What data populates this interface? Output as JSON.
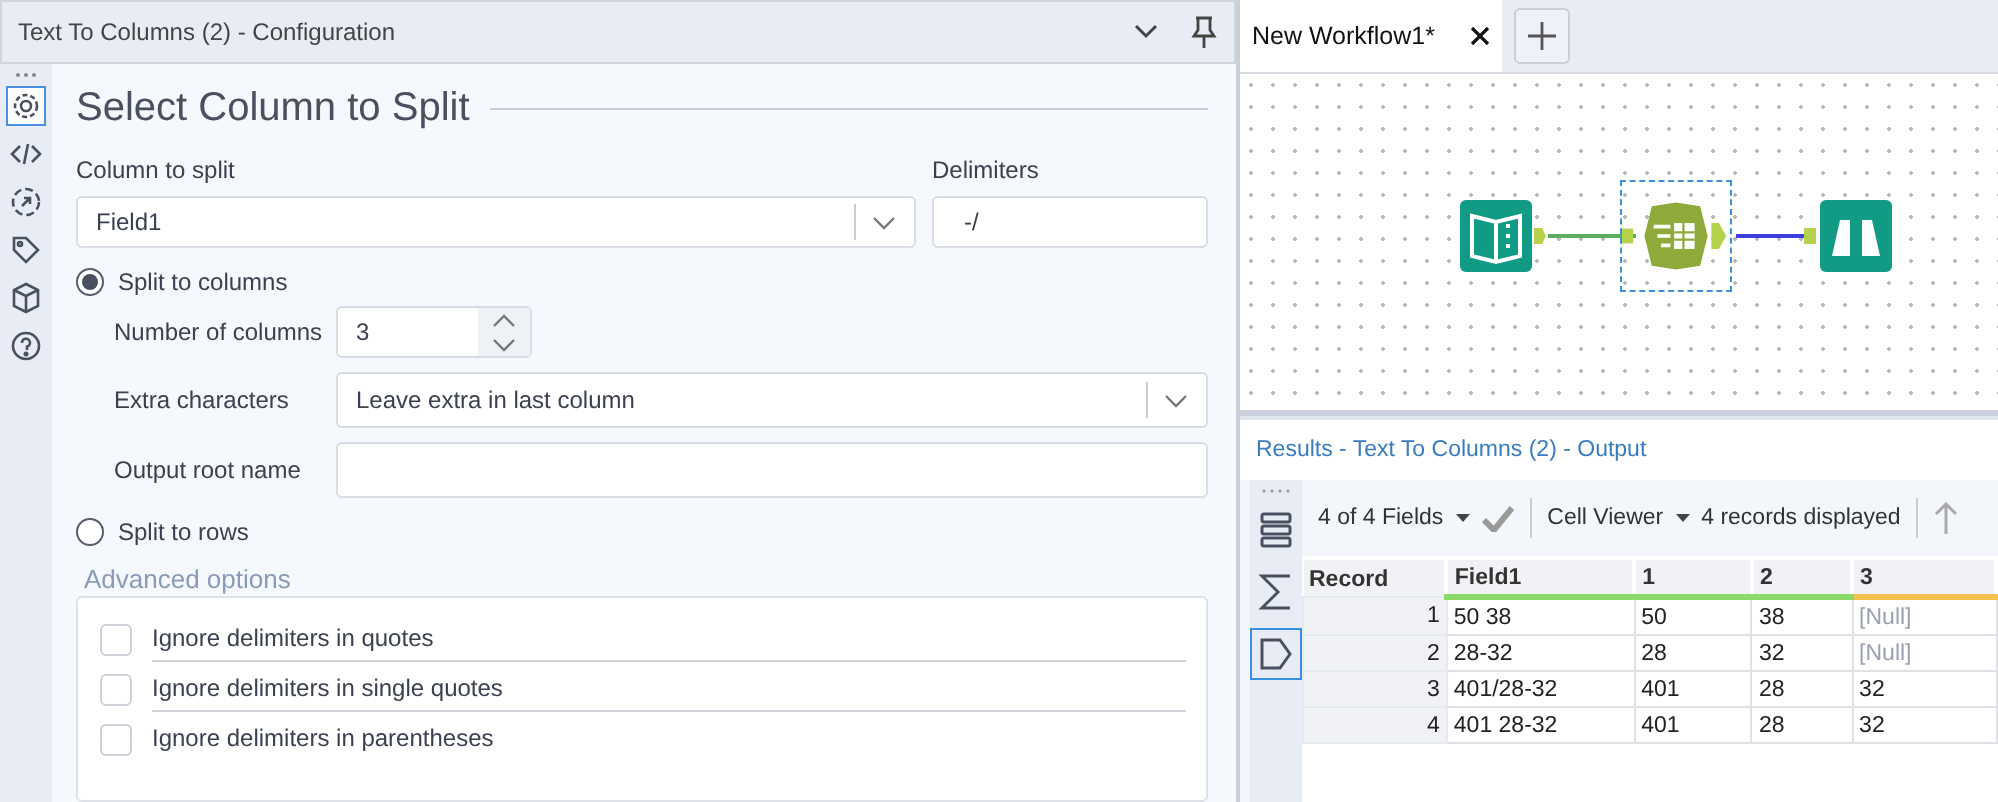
{
  "config_panel": {
    "title": "Text To Columns (2) - Configuration",
    "side_tools": [
      {
        "kind": "gear",
        "selected": true
      },
      {
        "kind": "code",
        "selected": false
      },
      {
        "kind": "arrow",
        "selected": false
      },
      {
        "kind": "tag",
        "selected": false
      },
      {
        "kind": "cube",
        "selected": false
      },
      {
        "kind": "help",
        "selected": false
      }
    ],
    "heading": "Select Column to Split",
    "column_to_split": {
      "label": "Column to split",
      "value": "Field1"
    },
    "delimiters": {
      "label": "Delimiters",
      "value": "-/"
    },
    "split_to_columns": {
      "label": "Split to columns",
      "selected": true
    },
    "number_of_columns": {
      "label": "Number of columns",
      "value": "3"
    },
    "extra_characters": {
      "label": "Extra characters",
      "value": "Leave extra in last column"
    },
    "output_root_name": {
      "label": "Output root name"
    },
    "split_to_rows": {
      "label": "Split to rows",
      "selected": false
    },
    "advanced_options": {
      "title": "Advanced options",
      "options": [
        {
          "label": "Ignore delimiters in quotes",
          "checked": false
        },
        {
          "label": "Ignore delimiters in single quotes",
          "checked": false
        },
        {
          "label": "Ignore delimiters in parentheses",
          "checked": false
        }
      ]
    }
  },
  "workflow": {
    "tabs": [
      {
        "label": "New Workflow1*",
        "selected": true
      }
    ],
    "nodes": [
      {
        "kind": "input",
        "selected": false
      },
      {
        "kind": "text_to_columns",
        "selected": true
      },
      {
        "kind": "browse",
        "selected": false
      }
    ]
  },
  "results": {
    "title": "Results - Text To Columns (2) - Output",
    "side_views": [
      {
        "kind": "rows",
        "selected": false
      },
      {
        "kind": "sigma",
        "selected": false
      },
      {
        "kind": "tag",
        "selected": true
      }
    ],
    "fields": "4 of 4 Fields",
    "viewer": "Cell Viewer",
    "records": "4 records displayed",
    "table": {
      "columns": [
        {
          "label": "Record"
        },
        {
          "label": "Field1",
          "color": "#8cd96b"
        },
        {
          "label": "1",
          "color": "#8cd96b"
        },
        {
          "label": "2",
          "color": "#8cd96b"
        },
        {
          "label": "3",
          "color": "#f2c14e"
        }
      ],
      "rows": [
        {
          "cells": [
            {
              "text": "1",
              "is_null": false
            },
            {
              "text": "50 38",
              "is_null": false
            },
            {
              "text": "50",
              "is_null": false
            },
            {
              "text": "38",
              "is_null": false
            },
            {
              "text": "[Null]",
              "is_null": true
            }
          ]
        },
        {
          "cells": [
            {
              "text": "2",
              "is_null": false
            },
            {
              "text": "28-32",
              "is_null": false
            },
            {
              "text": "28",
              "is_null": false
            },
            {
              "text": "32",
              "is_null": false
            },
            {
              "text": "[Null]",
              "is_null": true
            }
          ]
        },
        {
          "cells": [
            {
              "text": "3",
              "is_null": false
            },
            {
              "text": "401/28-32",
              "is_null": false
            },
            {
              "text": "401",
              "is_null": false
            },
            {
              "text": "28",
              "is_null": false
            },
            {
              "text": "32",
              "is_null": false
            }
          ]
        },
        {
          "cells": [
            {
              "text": "4",
              "is_null": false
            },
            {
              "text": "401 28-32",
              "is_null": false
            },
            {
              "text": "401",
              "is_null": false
            },
            {
              "text": "28",
              "is_null": false
            },
            {
              "text": "32",
              "is_null": false
            }
          ]
        }
      ]
    }
  }
}
